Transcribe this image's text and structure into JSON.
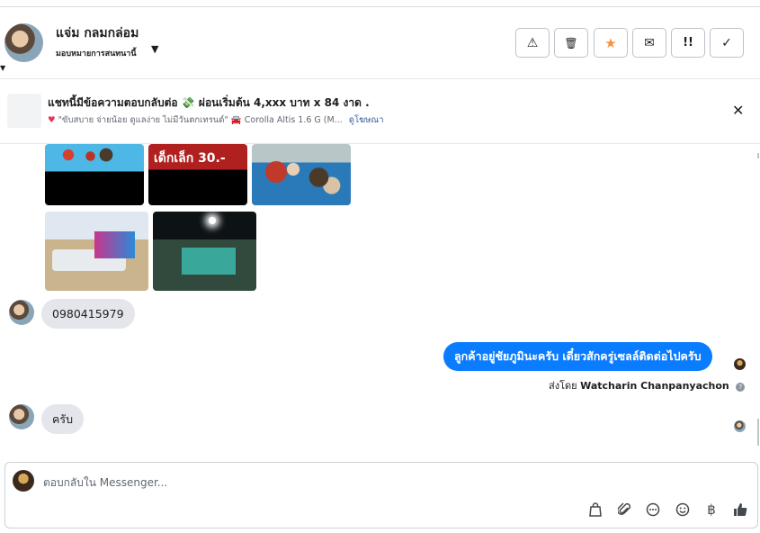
{
  "header": {
    "contact_name": "แจ่ม กลมกล่อม",
    "contact_subtitle": "มอบหมายการสนทนานี้",
    "actions": [
      {
        "icon": "warning-icon",
        "glyph": "⚠"
      },
      {
        "icon": "trash-icon",
        "glyph": "🗑"
      },
      {
        "icon": "star-icon",
        "glyph": "★"
      },
      {
        "icon": "mark-unread-icon",
        "glyph": "✉"
      },
      {
        "icon": "mark-important-icon",
        "glyph": "!!"
      },
      {
        "icon": "check-icon",
        "glyph": "✓"
      }
    ]
  },
  "ad": {
    "title_prefix": "แชทนี้มีข้อความตอบกลับต่อ",
    "title_money_icon": "💸",
    "title_suffix": "ผ่อนเริ่มต้น 4,xxx บาท x 84 งาด .",
    "sub_text": "\"ขับสบาย จ่ายน้อย ดูแลง่าย ไม่มีวันตกเทรนด์\"",
    "sub_car": "Corolla Altis 1.6 G (M...",
    "link_label": "ดูโฆษณา",
    "close_glyph": "✕"
  },
  "thread": {
    "image_text": "เด็กเล็ก  30.-",
    "messages": [
      {
        "direction": "in",
        "text": "0980415979"
      },
      {
        "direction": "out",
        "text": "ลูกค้าอยู่ชัยภูมินะครับ เดี๋ยวสักครู่เซลล์ติดต่อไปครับ"
      },
      {
        "direction": "in",
        "text": "ครับ"
      }
    ],
    "sent_by_prefix": "ส่งโดย",
    "sent_by_name": "Watcharin Chanpanyachon"
  },
  "composer": {
    "placeholder": "ตอบกลับใน Messenger...",
    "icons": [
      {
        "name": "bag-icon",
        "glyph": "🛍"
      },
      {
        "name": "attach-icon",
        "glyph": "📎"
      },
      {
        "name": "saved-reply-icon",
        "glyph": "💬"
      },
      {
        "name": "emoji-icon",
        "glyph": "☺"
      },
      {
        "name": "baht-icon",
        "glyph": "฿"
      },
      {
        "name": "like-icon",
        "glyph": "👍"
      }
    ]
  },
  "colors": {
    "accent": "#0a7cff",
    "star": "#f7923b"
  }
}
